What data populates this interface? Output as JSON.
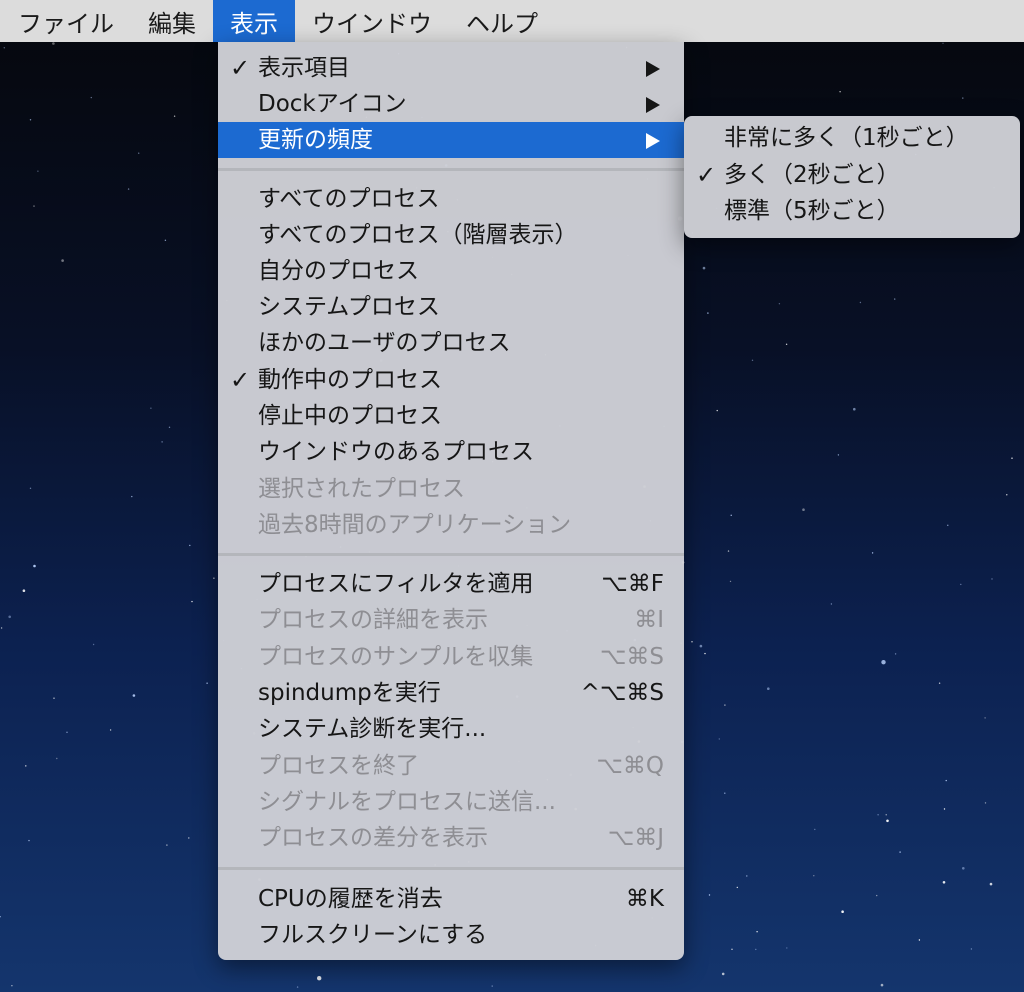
{
  "menubar": {
    "items": [
      "ファイル",
      "編集",
      "表示",
      "ウインドウ",
      "ヘルプ"
    ],
    "active_index": 2
  },
  "menu": {
    "items": [
      {
        "label": "表示項目",
        "checked": true,
        "submenu": true
      },
      {
        "label": "Dockアイコン",
        "submenu": true
      },
      {
        "label": "更新の頻度",
        "submenu": true,
        "highlighted": true
      },
      {
        "label": "すべてのプロセス"
      },
      {
        "label": "すべてのプロセス（階層表示）"
      },
      {
        "label": "自分のプロセス"
      },
      {
        "label": "システムプロセス"
      },
      {
        "label": "ほかのユーザのプロセス"
      },
      {
        "label": "動作中のプロセス",
        "checked": true
      },
      {
        "label": "停止中のプロセス"
      },
      {
        "label": "ウインドウのあるプロセス"
      },
      {
        "label": "選択されたプロセス",
        "disabled": true
      },
      {
        "label": "過去8時間のアプリケーション",
        "disabled": true
      },
      {
        "label": "プロセスにフィルタを適用",
        "shortcut": "⌥⌘F"
      },
      {
        "label": "プロセスの詳細を表示",
        "shortcut": "⌘I",
        "disabled": true
      },
      {
        "label": "プロセスのサンプルを収集",
        "shortcut": "⌥⌘S",
        "disabled": true
      },
      {
        "label": "spindumpを実行",
        "shortcut": "^⌥⌘S"
      },
      {
        "label": "システム診断を実行...",
        "shortcut": ""
      },
      {
        "label": "プロセスを終了",
        "shortcut": "⌥⌘Q",
        "disabled": true
      },
      {
        "label": "シグナルをプロセスに送信...",
        "disabled": true
      },
      {
        "label": "プロセスの差分を表示",
        "shortcut": "⌥⌘J",
        "disabled": true
      },
      {
        "label": "CPUの履歴を消去",
        "shortcut": "⌘K"
      },
      {
        "label": "フルスクリーンにする"
      }
    ]
  },
  "submenu": {
    "items": [
      {
        "label": "非常に多く（1秒ごと）"
      },
      {
        "label": "多く（2秒ごと）",
        "checked": true
      },
      {
        "label": "標準（5秒ごと）"
      }
    ]
  },
  "glyphs": {
    "check": "✓"
  },
  "colors": {
    "accent": "#1c6ad1",
    "menu_bg": "#ced0d6",
    "disabled_text": "#8e8e93"
  }
}
